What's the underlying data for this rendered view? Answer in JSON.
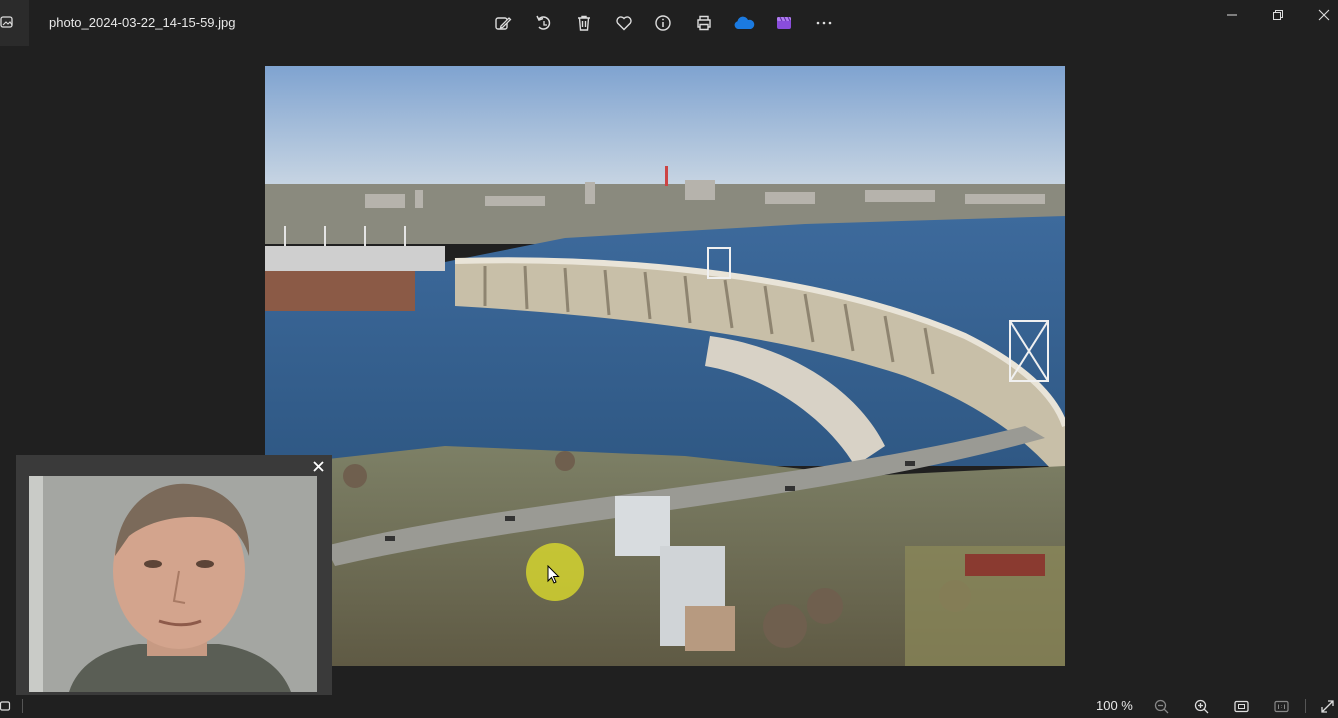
{
  "window": {
    "filename": "photo_2024-03-22_14-15-59.jpg",
    "controls": [
      "minimize",
      "restore",
      "close"
    ]
  },
  "toolbar": {
    "items": [
      {
        "name": "edit-image-icon"
      },
      {
        "name": "rotate-icon"
      },
      {
        "name": "delete-icon"
      },
      {
        "name": "favorite-icon"
      },
      {
        "name": "info-icon"
      },
      {
        "name": "print-icon"
      },
      {
        "name": "onedrive-icon"
      },
      {
        "name": "clipchamp-icon"
      },
      {
        "name": "more-options-icon"
      }
    ],
    "colors": {
      "onedrive": "#1b7ae0",
      "clipchamp": "#8a4ddc"
    }
  },
  "statusbar": {
    "zoom": "100 %",
    "buttons": [
      "zoom-out-icon",
      "zoom-in-icon",
      "fit-window-icon",
      "actual-size-icon",
      "fullscreen-icon"
    ]
  },
  "overlay": {
    "webcam": "webcam-feed",
    "close_icon": "close-icon"
  }
}
